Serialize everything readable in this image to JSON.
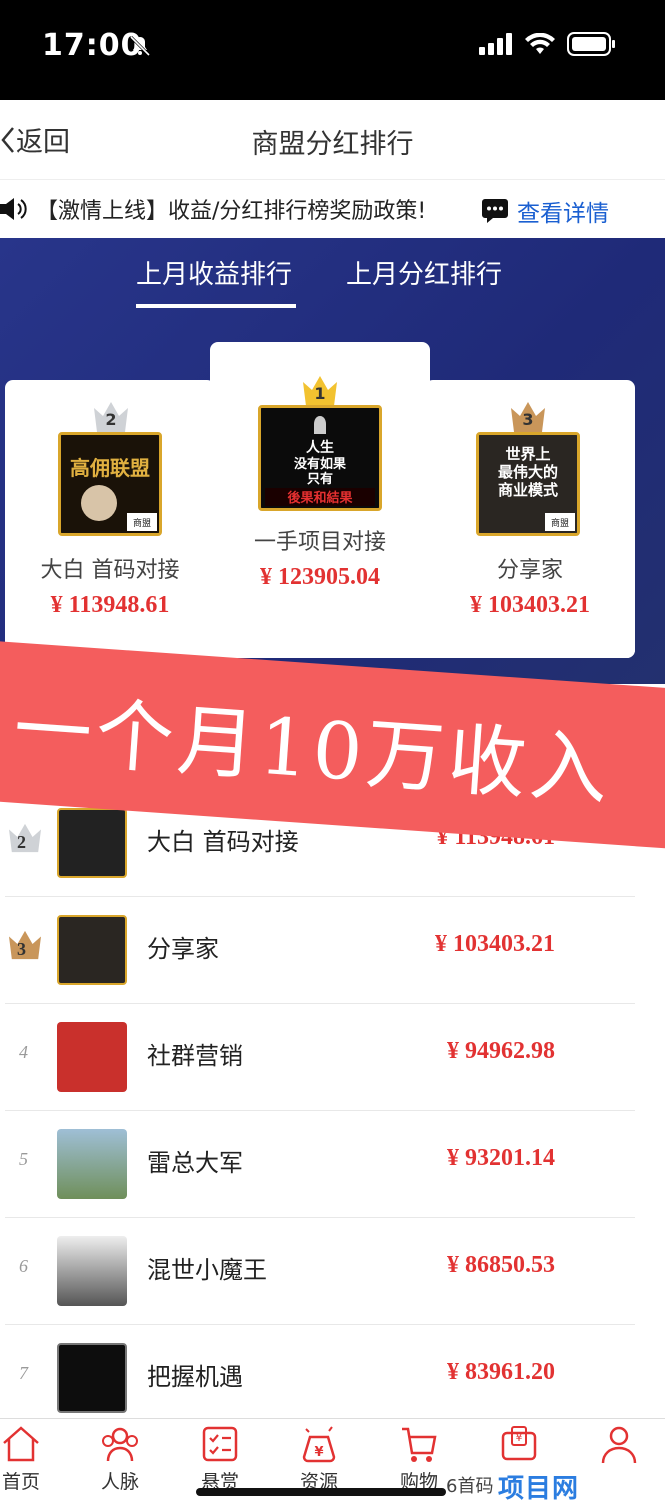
{
  "status_bar": {
    "time": "17:00"
  },
  "nav": {
    "back_label": "返回",
    "title": "商盟分红排行"
  },
  "notice": {
    "text": "【激情上线】收益/分红排行榜奖励政策!",
    "link": "查看详情"
  },
  "tabs": [
    {
      "label": "上月收益排行",
      "active": true
    },
    {
      "label": "上月分红排行",
      "active": false
    }
  ],
  "podium": {
    "first": {
      "rank": "1",
      "name": "一手项目对接",
      "amount": "¥ 123905.04",
      "avatar_lines": [
        "人生",
        "没有如果",
        "只有",
        "後果和結果"
      ]
    },
    "second": {
      "rank": "2",
      "name": "大白 首码对接",
      "amount": "¥ 113948.61",
      "avatar_text": "高佣联盟"
    },
    "third": {
      "rank": "3",
      "name": "分享家",
      "amount": "¥ 103403.21",
      "avatar_lines": [
        "世界上",
        "最伟大的",
        "商业模式"
      ]
    }
  },
  "overlay_text": "一个月10万收入",
  "avatar_badge": "商盟",
  "list": [
    {
      "rank": "2",
      "name": "大白 首码对接",
      "amount": "¥ 113948.61"
    },
    {
      "rank": "3",
      "name": "分享家",
      "amount": "¥ 103403.21"
    },
    {
      "rank": "4",
      "name": "社群营销",
      "amount": "¥ 94962.98"
    },
    {
      "rank": "5",
      "name": "雷总大军",
      "amount": "¥ 93201.14"
    },
    {
      "rank": "6",
      "name": "混世小魔王",
      "amount": "¥ 86850.53"
    },
    {
      "rank": "7",
      "name": "把握机遇",
      "amount": "¥ 83961.20"
    }
  ],
  "tabbar": [
    {
      "label": "首页",
      "icon": "home-icon"
    },
    {
      "label": "人脉",
      "icon": "contacts-icon"
    },
    {
      "label": "悬赏",
      "icon": "task-icon"
    },
    {
      "label": "资源",
      "icon": "resource-icon"
    },
    {
      "label": "购物",
      "icon": "shopping-icon"
    },
    {
      "label": "",
      "icon": "wallet-icon"
    },
    {
      "label": "",
      "icon": "profile-icon"
    }
  ],
  "watermark": {
    "prefix": "6首码",
    "brand": "项目网"
  },
  "colors": {
    "accent": "#e23232",
    "banner": "#28358a",
    "link": "#1a5fd1",
    "overlay": "#f45d5d"
  }
}
